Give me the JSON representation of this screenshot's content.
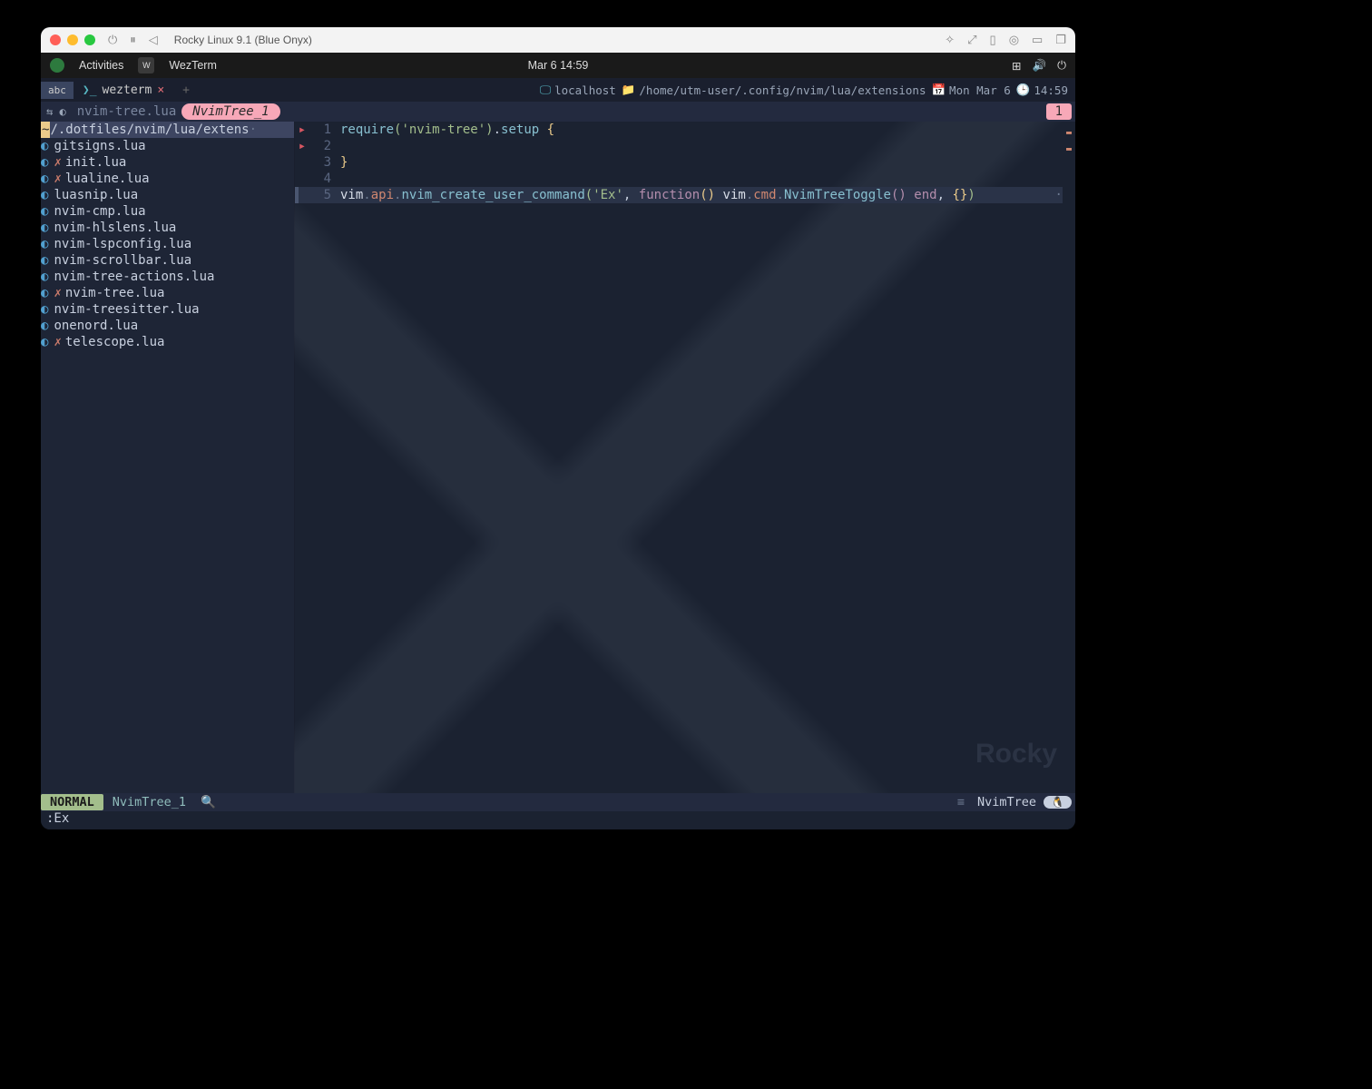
{
  "titlebar": {
    "title": "Rocky Linux 9.1 (Blue Onyx)"
  },
  "gnome": {
    "activities": "Activities",
    "app": "WezTerm",
    "clock": "Mar 6  14:59"
  },
  "wezterm": {
    "tab_label": "wezterm",
    "host": "localhost",
    "cwd": "/home/utm-user/.config/nvim/lua/extensions",
    "date": "Mon Mar 6",
    "time": "14:59"
  },
  "bufferline": {
    "file": "nvim-tree.lua",
    "pill": "NvimTree_1",
    "count": "1"
  },
  "tree": {
    "root": "/.dotfiles/nvim/lua/extens",
    "root_ellipsis": "·",
    "files": [
      {
        "name": "gitsigns.lua",
        "modified": false
      },
      {
        "name": "init.lua",
        "modified": true
      },
      {
        "name": "lualine.lua",
        "modified": true
      },
      {
        "name": "luasnip.lua",
        "modified": false
      },
      {
        "name": "nvim-cmp.lua",
        "modified": false
      },
      {
        "name": "nvim-hlslens.lua",
        "modified": false
      },
      {
        "name": "nvim-lspconfig.lua",
        "modified": false
      },
      {
        "name": "nvim-scrollbar.lua",
        "modified": false
      },
      {
        "name": "nvim-tree-actions.lua",
        "modified": false
      },
      {
        "name": "nvim-tree.lua",
        "modified": true
      },
      {
        "name": "nvim-treesitter.lua",
        "modified": false
      },
      {
        "name": "onenord.lua",
        "modified": false
      },
      {
        "name": "telescope.lua",
        "modified": true
      }
    ]
  },
  "code": {
    "lines": [
      {
        "n": 1,
        "sign": "▸",
        "tokens": [
          {
            "t": "require",
            "c": "fn"
          },
          {
            "t": "(",
            "c": "paren"
          },
          {
            "t": "'nvim-tree'",
            "c": "str"
          },
          {
            "t": ")",
            "c": "paren"
          },
          {
            "t": ".",
            "c": "punct"
          },
          {
            "t": "setup",
            "c": "fn"
          },
          {
            "t": " {",
            "c": "paren2"
          }
        ]
      },
      {
        "n": 2,
        "sign": "▸",
        "tokens": []
      },
      {
        "n": 3,
        "sign": "",
        "tokens": [
          {
            "t": "}",
            "c": "paren2"
          }
        ]
      },
      {
        "n": 4,
        "sign": "",
        "tokens": []
      },
      {
        "n": 5,
        "sign": "",
        "hl": true,
        "trail": "·",
        "tokens": [
          {
            "t": "vim",
            "c": "id"
          },
          {
            "t": ".",
            "c": "dim2"
          },
          {
            "t": "api",
            "c": "prop"
          },
          {
            "t": ".",
            "c": "dim2"
          },
          {
            "t": "nvim_create_user_command",
            "c": "fn"
          },
          {
            "t": "(",
            "c": "paren"
          },
          {
            "t": "'Ex'",
            "c": "str"
          },
          {
            "t": ", ",
            "c": "punct"
          },
          {
            "t": "function",
            "c": "kw"
          },
          {
            "t": "()",
            "c": "paren2"
          },
          {
            "t": " ",
            "c": "punct"
          },
          {
            "t": "vim",
            "c": "id"
          },
          {
            "t": ".",
            "c": "dim2"
          },
          {
            "t": "cmd",
            "c": "prop"
          },
          {
            "t": ".",
            "c": "dim2"
          },
          {
            "t": "NvimTreeToggle",
            "c": "fn"
          },
          {
            "t": "()",
            "c": "paren3"
          },
          {
            "t": " ",
            "c": "punct"
          },
          {
            "t": "end",
            "c": "kw"
          },
          {
            "t": ", ",
            "c": "punct"
          },
          {
            "t": "{}",
            "c": "paren2"
          },
          {
            "t": ")",
            "c": "paren"
          }
        ]
      }
    ]
  },
  "statusline": {
    "mode": "NORMAL",
    "file": "NvimTree_1",
    "filetype": "NvimTree"
  },
  "cmdline": ":Ex",
  "brand": "Rocky"
}
